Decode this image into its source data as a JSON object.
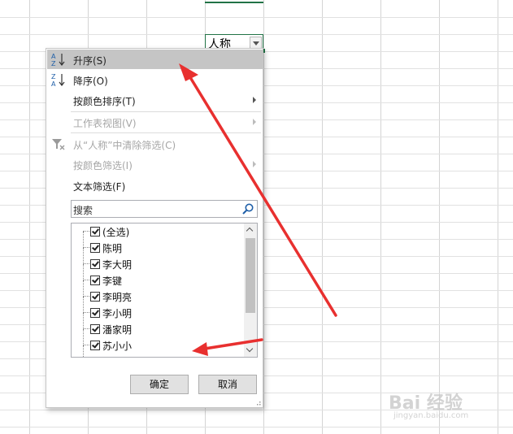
{
  "cell": {
    "header_value": "人称"
  },
  "menu": {
    "items": [
      {
        "label": "升序(S)",
        "icon": "sort-ascending-icon",
        "enabled": true,
        "highlighted": true,
        "submenu": false
      },
      {
        "label": "降序(O)",
        "icon": "sort-descending-icon",
        "enabled": true,
        "highlighted": false,
        "submenu": false
      },
      {
        "label": "按颜色排序(T)",
        "icon": "",
        "enabled": true,
        "highlighted": false,
        "submenu": true
      },
      {
        "label": "工作表视图(V)",
        "icon": "",
        "enabled": false,
        "highlighted": false,
        "submenu": true
      },
      {
        "label": "从“人称”中清除筛选(C)",
        "icon": "clear-filter-icon",
        "enabled": false,
        "highlighted": false,
        "submenu": false
      },
      {
        "label": "按颜色筛选(I)",
        "icon": "",
        "enabled": false,
        "highlighted": false,
        "submenu": true
      },
      {
        "label": "文本筛选(F)",
        "icon": "",
        "enabled": true,
        "highlighted": false,
        "submenu": false
      }
    ],
    "search": {
      "placeholder": "搜索"
    },
    "list": [
      {
        "label": "(全选)",
        "checked": true
      },
      {
        "label": "陈明",
        "checked": true
      },
      {
        "label": "李大明",
        "checked": true
      },
      {
        "label": "李键",
        "checked": true
      },
      {
        "label": "李明亮",
        "checked": true
      },
      {
        "label": "李小明",
        "checked": true
      },
      {
        "label": "潘家明",
        "checked": true
      },
      {
        "label": "苏小小",
        "checked": true
      },
      {
        "label": "",
        "checked": false
      }
    ],
    "ok_label": "确定",
    "cancel_label": "取消"
  },
  "watermark": {
    "line1": "Bai 经验",
    "line2": "jingyan.baidu.com"
  },
  "colors": {
    "arrow": "#e8302f",
    "accent": "#217346",
    "highlight": "#c5c5c5"
  }
}
